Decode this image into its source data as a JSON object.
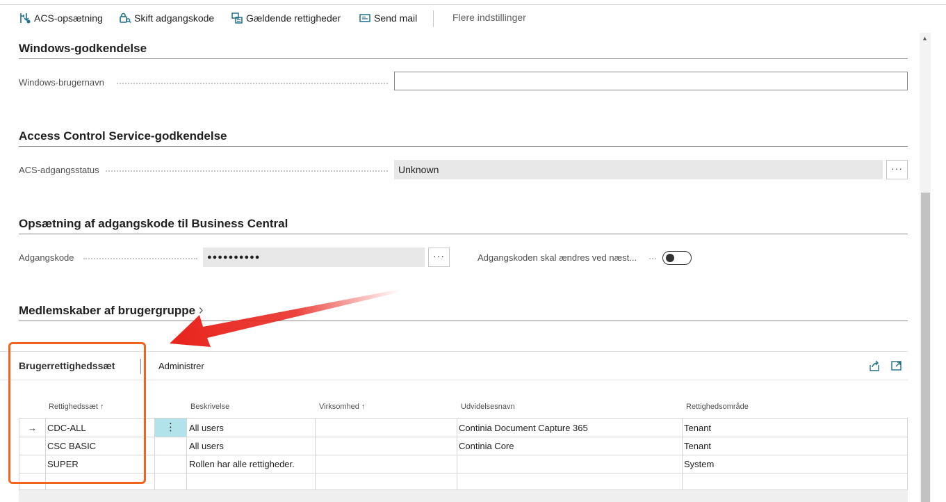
{
  "actions": {
    "acs_setup": "ACS-opsætning",
    "change_password": "Skift adgangskode",
    "effective_permissions": "Gældende rettigheder",
    "send_mail": "Send mail",
    "more_options": "Flere indstillinger"
  },
  "windows_auth": {
    "title": "Windows-godkendelse",
    "username_label": "Windows-brugernavn",
    "username_value": ""
  },
  "acs_auth": {
    "title": "Access Control Service-godkendelse",
    "status_label": "ACS-adgangsstatus",
    "status_value": "Unknown",
    "ellipsis": "···"
  },
  "password_setup": {
    "title": "Opsætning af adgangskode til Business Central",
    "password_label": "Adgangskode",
    "password_value": "●●●●●●●●●●",
    "ellipsis": "···",
    "change_next_label": "Adgangskoden skal ændres ved næst..."
  },
  "group_memberships": {
    "title": "Medlemskaber af brugergruppe",
    "chevron": "›"
  },
  "permission_sets_part": {
    "tab_label": "Brugerrettighedssæt",
    "manage_label": "Administrer",
    "columns": [
      "Rettighedssæt ↑",
      "Beskrivelse",
      "Virksomhed ↑",
      "Udvidelsesnavn",
      "Rettighedsområde"
    ],
    "rows": [
      {
        "set": "CDC-ALL",
        "description": "All users",
        "company": "",
        "extension": "Continia Document Capture 365",
        "scope": "Tenant"
      },
      {
        "set": "CSC BASIC",
        "description": "All users",
        "company": "",
        "extension": "Continia Core",
        "scope": "Tenant"
      },
      {
        "set": "SUPER",
        "description": "Rollen har alle rettigheder.",
        "company": "",
        "extension": "",
        "scope": "System"
      }
    ],
    "current_row_arrow": "→",
    "row_menu": "⋮"
  },
  "colors": {
    "highlight": "#f0641e",
    "arrow": "#e8231c",
    "selected_cell": "#b3e3ea",
    "readonly_bg": "#e8e8e8"
  }
}
